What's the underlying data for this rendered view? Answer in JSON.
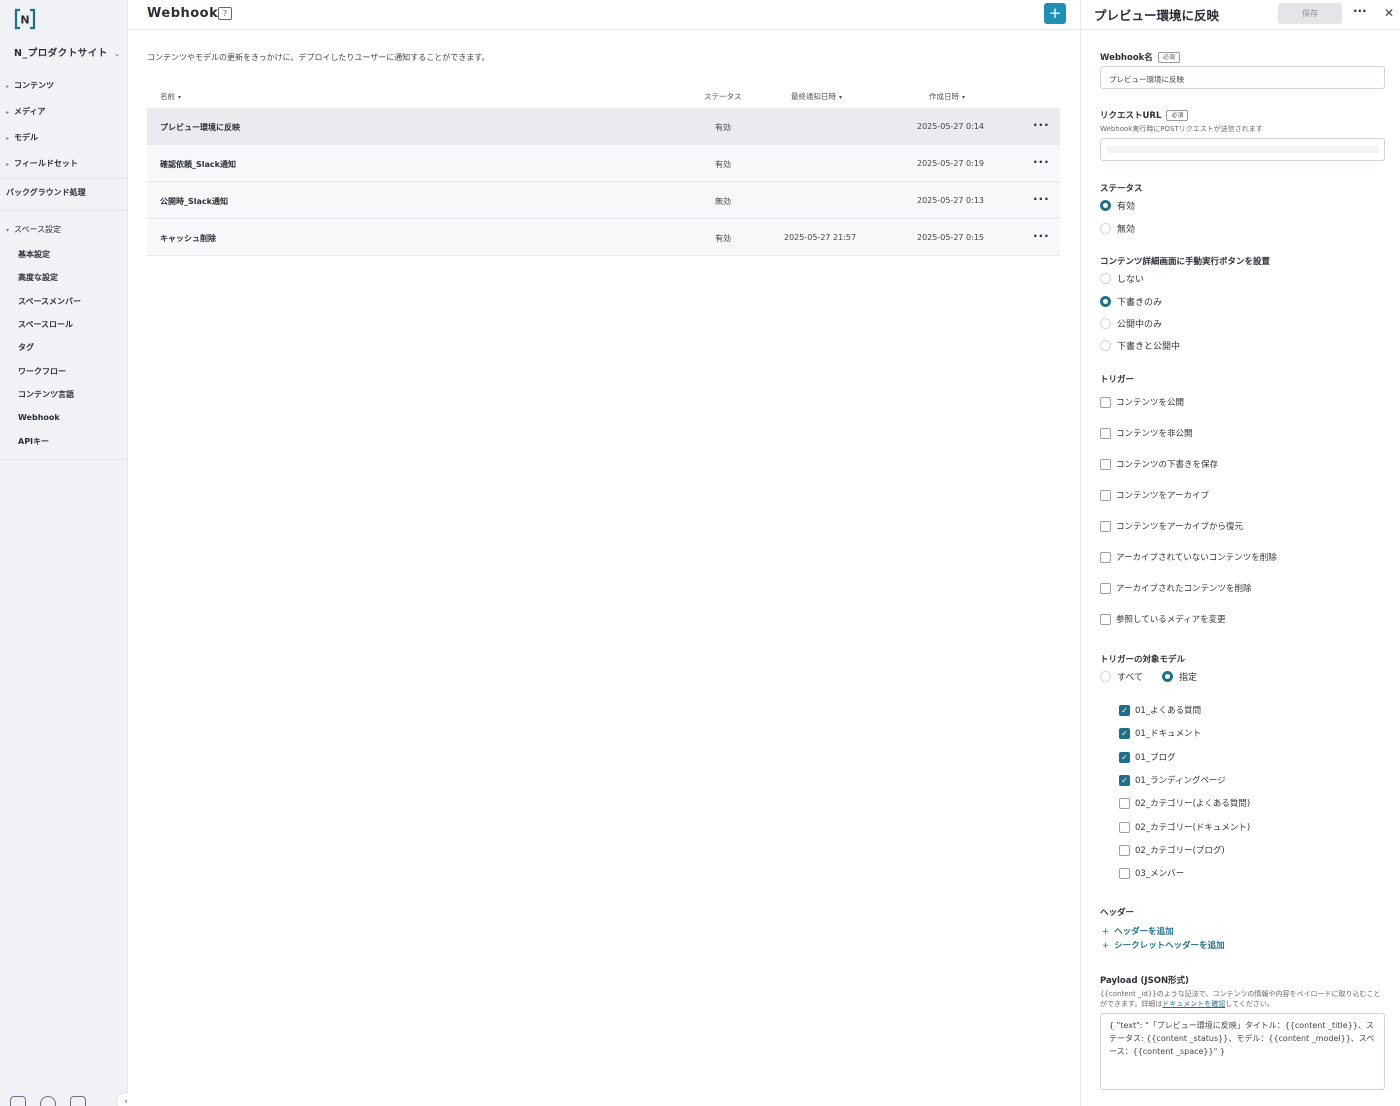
{
  "sidebar": {
    "logo_letter": "N",
    "space_name": "N_プロダクトサイト",
    "nav": [
      {
        "label": "コンテンツ"
      },
      {
        "label": "メディア"
      },
      {
        "label": "モデル"
      },
      {
        "label": "フィールドセット"
      }
    ],
    "background": "バックグラウンド処理",
    "space_settings": "スペース設定",
    "settings_items": [
      "基本設定",
      "高度な設定",
      "スペースメンバー",
      "スペースロール",
      "タグ",
      "ワークフロー",
      "コンテンツ言語",
      "Webhook",
      "APIキー"
    ]
  },
  "main": {
    "title": "Webhook",
    "help": "?",
    "add": "+",
    "description": "コンテンツやモデルの更新をきっかけに、デプロイしたりユーザーに通知することができます。",
    "columns": {
      "name": "名前",
      "status": "ステータス",
      "notified": "最終通知日時",
      "created": "作成日時"
    },
    "sort_icon": "▾",
    "more": "···",
    "rows": [
      {
        "name": "プレビュー環境に反映",
        "status": "有効",
        "notified": "",
        "created": "2025-05-27 0:14"
      },
      {
        "name": "確認依頼_Slack通知",
        "status": "有効",
        "notified": "",
        "created": "2025-05-27 0:19"
      },
      {
        "name": "公開時_Slack通知",
        "status": "無効",
        "notified": "",
        "created": "2025-05-27 0:13"
      },
      {
        "name": "キャッシュ削除",
        "status": "有効",
        "notified": "2025-05-27 21:57",
        "created": "2025-05-27 0:15"
      }
    ]
  },
  "panel": {
    "title": "プレビュー環境に反映",
    "save": "保存",
    "more": "···",
    "close": "✕",
    "required": "必須",
    "name_label": "Webhook名",
    "name_value": "プレビュー環境に反映",
    "url_label": "リクエストURL",
    "url_hint": "Webhook実行時にPOSTリクエストが送信されます",
    "status_label": "ステータス",
    "status_options": [
      "有効",
      "無効"
    ],
    "button_label": "コンテンツ詳細画面に手動実行ボタンを設置",
    "button_options": [
      "しない",
      "下書きのみ",
      "公開中のみ",
      "下書きと公開中"
    ],
    "trigger_label": "トリガー",
    "triggers": [
      "コンテンツを公開",
      "コンテンツを非公開",
      "コンテンツの下書きを保存",
      "コンテンツをアーカイブ",
      "コンテンツをアーカイブから復元",
      "アーカイブされていないコンテンツを削除",
      "アーカイブされたコンテンツを削除",
      "参照しているメディアを変更"
    ],
    "model_label": "トリガーの対象モデル",
    "model_scope": [
      "すべて",
      "指定"
    ],
    "models": [
      {
        "name": "01_よくある質問",
        "checked": true
      },
      {
        "name": "01_ドキュメント",
        "checked": true
      },
      {
        "name": "01_ブログ",
        "checked": true
      },
      {
        "name": "01_ランディングページ",
        "checked": true
      },
      {
        "name": "02_カテゴリー(よくある質問)",
        "checked": false
      },
      {
        "name": "02_カテゴリー(ドキュメント)",
        "checked": false
      },
      {
        "name": "02_カテゴリー(ブログ)",
        "checked": false
      },
      {
        "name": "03_メンバー",
        "checked": false
      }
    ],
    "header_label": "ヘッダー",
    "add_header": "ヘッダーを追加",
    "add_secret_header": "シークレットヘッダーを追加",
    "plus": "+",
    "payload_label": "Payload (JSON形式)",
    "payload_hint_1": "{{content _id}}のような記法で、コンテンツの情報や内容をペイロードに取り込むことができます。詳細は",
    "payload_hint_link": "ドキュメントを確認",
    "payload_hint_2": "してください。",
    "payload_value": "{ \"text\": \"「プレビュー環境に反映」タイトル：{{content _title}}、ステータス: {{content _status}}、モデル：{{content _model}}、スペース：{{content _space}}\" }"
  }
}
